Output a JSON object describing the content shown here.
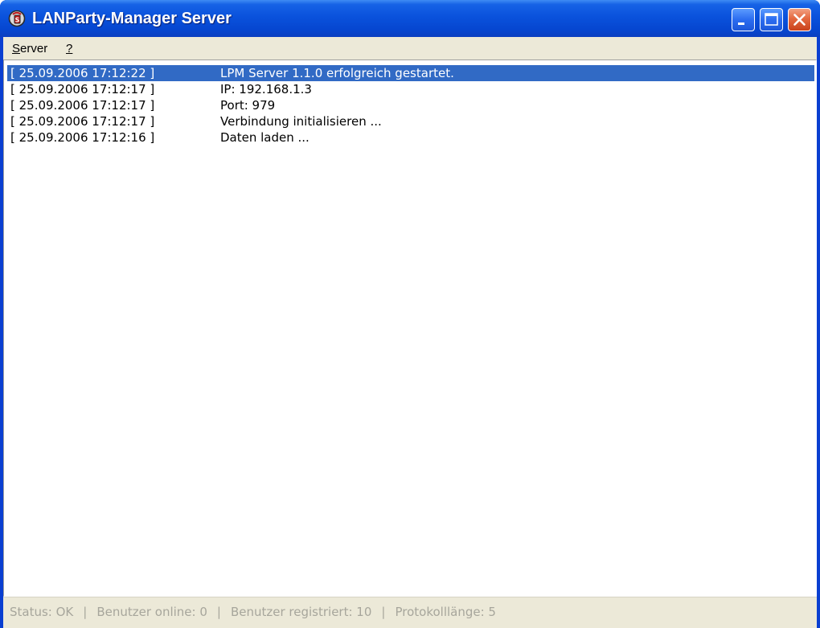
{
  "window": {
    "title": "LANParty-Manager Server",
    "icon": "lanparty-manager-app-icon",
    "controls": {
      "minimize_icon": "minimize-icon",
      "maximize_icon": "maximize-icon",
      "close_icon": "close-icon"
    }
  },
  "menu": {
    "server": {
      "accel": "S",
      "rest": "erver"
    },
    "help": {
      "label": "?"
    }
  },
  "log": {
    "rows": [
      {
        "time": "[ 25.09.2006 17:12:22 ]",
        "message": "LPM Server 1.1.0 erfolgreich gestartet.",
        "selected": true
      },
      {
        "time": "[ 25.09.2006 17:12:17 ]",
        "message": "IP: 192.168.1.3",
        "selected": false
      },
      {
        "time": "[ 25.09.2006 17:12:17 ]",
        "message": "Port: 979",
        "selected": false
      },
      {
        "time": "[ 25.09.2006 17:12:17 ]",
        "message": "Verbindung initialisieren ...",
        "selected": false
      },
      {
        "time": "[ 25.09.2006 17:12:16 ]",
        "message": "Daten laden ...",
        "selected": false
      }
    ]
  },
  "status": {
    "status": "Status: OK",
    "separator": "|",
    "users_online": "Benutzer online: 0",
    "users_registered": "Benutzer registriert: 10",
    "log_length": "Protokolllänge: 5"
  },
  "colors": {
    "selection": "#316ac5",
    "titlebar": "#0a52dc",
    "close_button": "#e4683f",
    "face": "#ece9d8",
    "status_text": "#a7a69c"
  }
}
